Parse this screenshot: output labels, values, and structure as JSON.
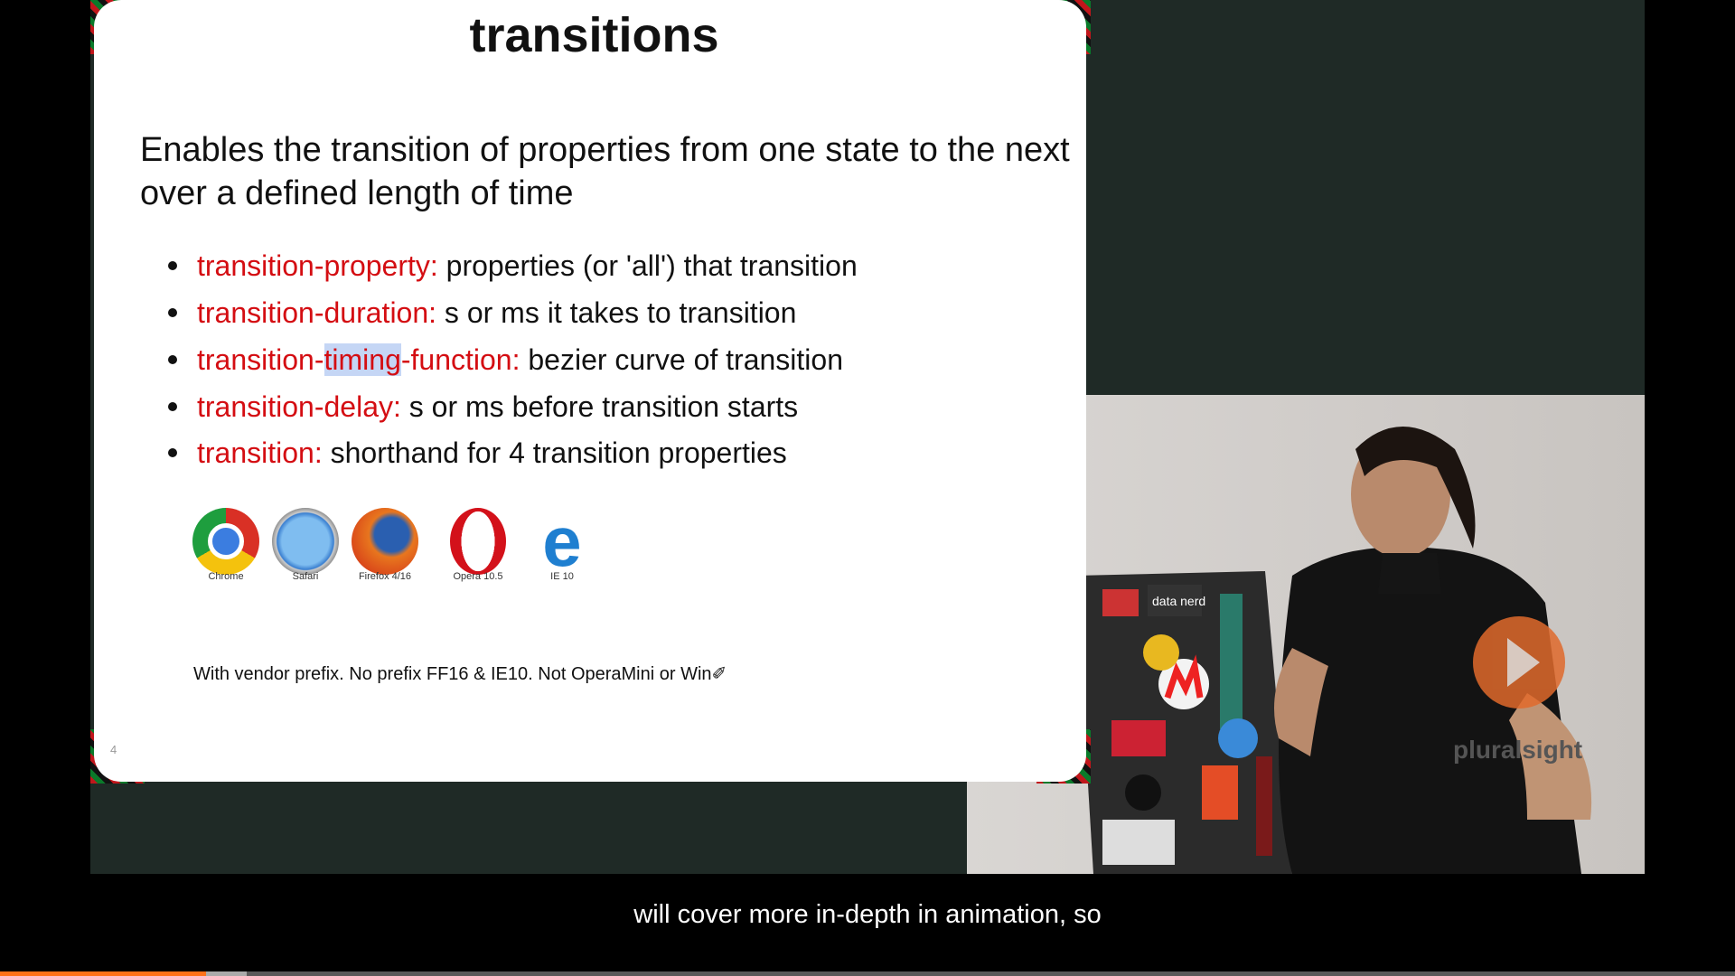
{
  "slide": {
    "title": "transitions",
    "intro": "Enables the transition of properties from one state to the next over a defined length of time",
    "bullets": [
      {
        "term": "transition-property:",
        "desc": " properties (or 'all') that transition"
      },
      {
        "term_pre": "transition-",
        "term_hl": "timing",
        "term_post": "-function:"
      },
      {
        "term": "transition-duration:",
        "desc": " s or ms it takes to transition"
      },
      {
        "term": "transition-delay:",
        "desc": " s or ms before transition starts"
      },
      {
        "term": "transition:",
        "desc": " shorthand for 4 transition properties"
      }
    ],
    "timing_desc": " bezier curve of transition",
    "browsers": [
      {
        "name": "Chrome",
        "icon": "chrome-icon"
      },
      {
        "name": "Safari",
        "icon": "safari-icon"
      },
      {
        "name": "Firefox 4/16",
        "icon": "firefox-icon"
      },
      {
        "name": "Opera 10.5",
        "icon": "opera-icon"
      },
      {
        "name": "IE 10",
        "icon": "ie-icon"
      }
    ],
    "footnote": "With vendor prefix. No prefix FF16 & IE10. Not OperaMini or Win✐",
    "page_number": "4",
    "highlight_color": "#c5d6f5",
    "term_color": "#d40d12"
  },
  "watermark": {
    "brand": "pluralsight",
    "color": "#e06a2c"
  },
  "subtitle": "will cover more in-depth in animation, so",
  "progress": {
    "played_percent": 11.9,
    "buffered_percent": 14.2,
    "played_color": "#ff7118",
    "buffered_color": "#aaaaaa"
  }
}
